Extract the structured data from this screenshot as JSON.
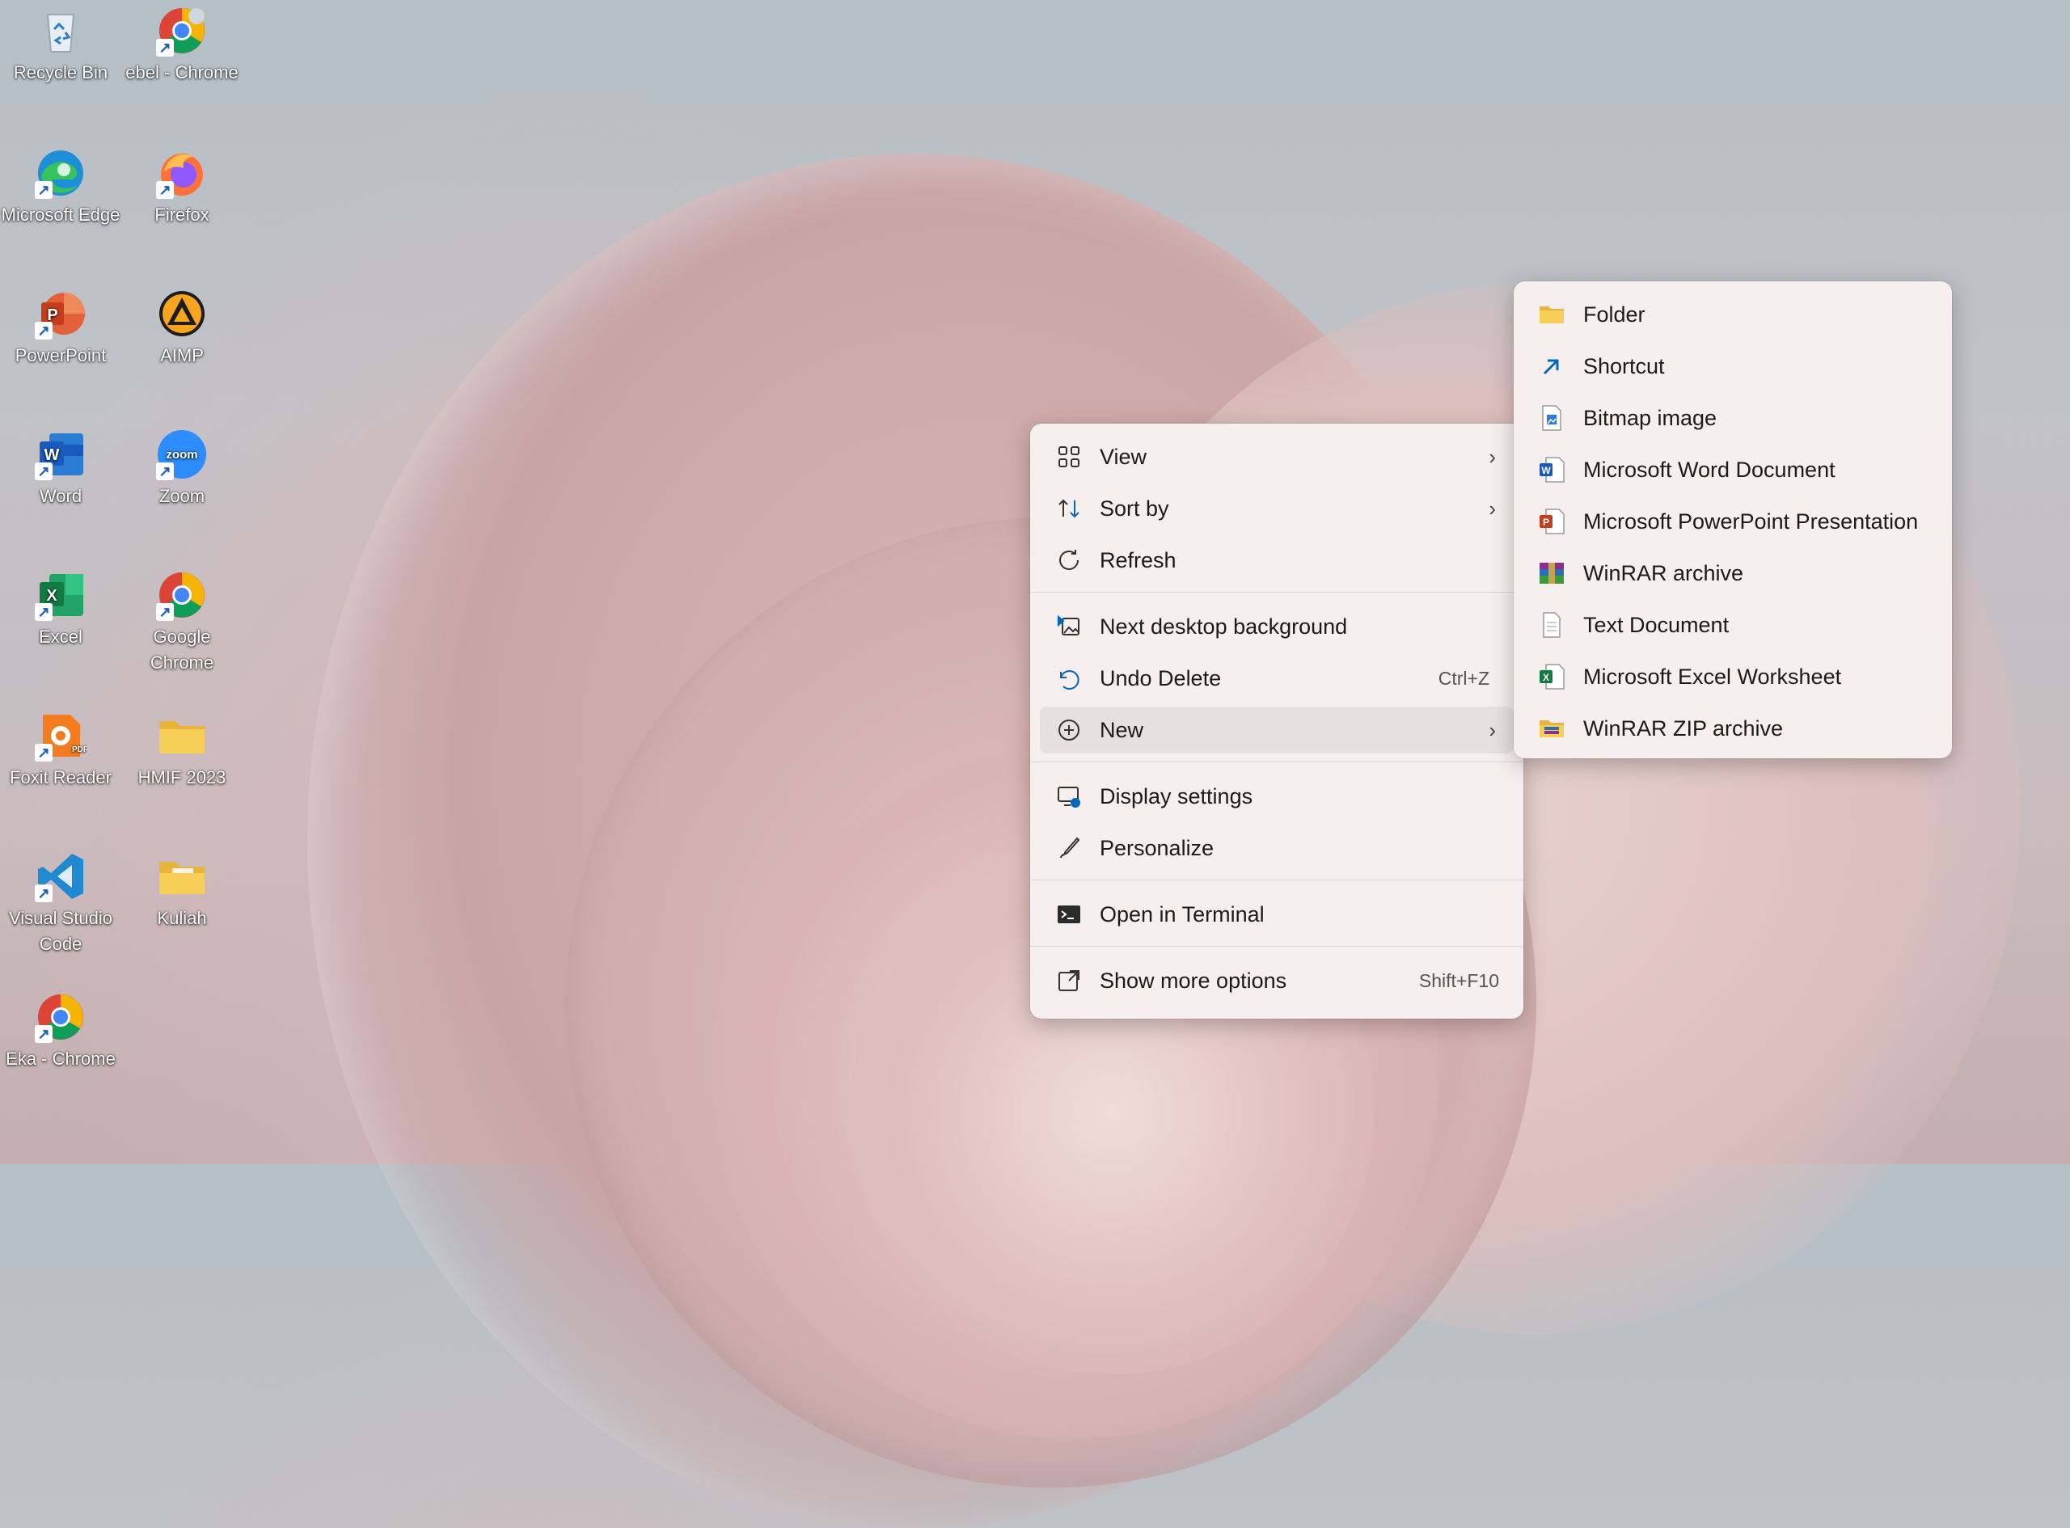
{
  "desktop": {
    "icons": [
      {
        "label": "Recycle Bin",
        "icon": "recycle-bin-icon"
      },
      {
        "label": "ebel - Chrome",
        "icon": "chrome-icon"
      },
      {
        "label": "Microsoft Edge",
        "icon": "edge-icon"
      },
      {
        "label": "Firefox",
        "icon": "firefox-icon"
      },
      {
        "label": "PowerPoint",
        "icon": "powerpoint-icon"
      },
      {
        "label": "AIMP",
        "icon": "aimp-icon"
      },
      {
        "label": "Word",
        "icon": "word-icon"
      },
      {
        "label": "Zoom",
        "icon": "zoom-icon"
      },
      {
        "label": "Excel",
        "icon": "excel-icon"
      },
      {
        "label": "Google Chrome",
        "icon": "chrome-icon"
      },
      {
        "label": "Foxit Reader",
        "icon": "foxit-icon"
      },
      {
        "label": "HMIF 2023",
        "icon": "folder-icon"
      },
      {
        "label": "Visual Studio Code",
        "icon": "vscode-icon"
      },
      {
        "label": "Kuliah",
        "icon": "folder-icon"
      },
      {
        "label": "Eka - Chrome",
        "icon": "chrome-icon"
      }
    ]
  },
  "context_menu": {
    "items": [
      {
        "label": "View",
        "icon": "grid-view-icon"
      },
      {
        "label": "Sort by",
        "icon": "sort-icon"
      },
      {
        "label": "Refresh",
        "icon": "refresh-icon"
      },
      {
        "label": "Next desktop background",
        "icon": "next-background-icon"
      },
      {
        "label": "Undo Delete",
        "shortcut": "Ctrl+Z",
        "icon": "undo-icon"
      },
      {
        "label": "New",
        "icon": "add-circle-icon"
      },
      {
        "label": "Display settings",
        "icon": "display-settings-icon"
      },
      {
        "label": "Personalize",
        "icon": "brush-icon"
      },
      {
        "label": "Open in Terminal",
        "icon": "terminal-icon"
      },
      {
        "label": "Show more options",
        "shortcut": "Shift+F10",
        "icon": "show-more-icon"
      }
    ]
  },
  "new_submenu": {
    "items": [
      {
        "label": "Folder",
        "icon": "folder-icon"
      },
      {
        "label": "Shortcut",
        "icon": "shortcut-icon"
      },
      {
        "label": "Bitmap image",
        "icon": "bitmap-icon"
      },
      {
        "label": "Microsoft Word Document",
        "icon": "word-doc-icon"
      },
      {
        "label": "Microsoft PowerPoint Presentation",
        "icon": "powerpoint-doc-icon"
      },
      {
        "label": "WinRAR archive",
        "icon": "winrar-icon"
      },
      {
        "label": "Text Document",
        "icon": "text-doc-icon"
      },
      {
        "label": "Microsoft Excel Worksheet",
        "icon": "excel-doc-icon"
      },
      {
        "label": "WinRAR ZIP archive",
        "icon": "winrar-zip-icon"
      }
    ]
  },
  "colors": {
    "menu_bg": "#f7efef",
    "active_item_bg": "#e8e0e0",
    "accent": "#0067c0"
  }
}
